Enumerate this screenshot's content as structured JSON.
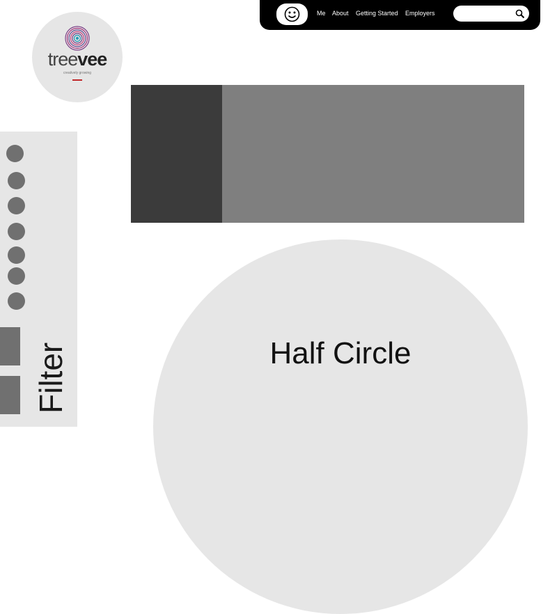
{
  "nav": {
    "items": [
      {
        "label": "Me"
      },
      {
        "label": "About"
      },
      {
        "label": "Getting Started"
      },
      {
        "label": "Employers"
      }
    ],
    "search": {
      "value": "",
      "placeholder": ""
    },
    "smiley_icon": "smiley-face-icon",
    "search_icon": "magnifier-icon"
  },
  "logo": {
    "text_light": "tree",
    "text_bold": "vee",
    "tagline": "creatively growing",
    "icon": "concentric-rings-icon"
  },
  "sidebar": {
    "filter_label": "Filter",
    "dot_count_shown": 7,
    "block_count_shown": 2
  },
  "main": {
    "half_circle_label": "Half Circle"
  },
  "colors": {
    "nav_background": "#000000",
    "banner_dark": "#3b3b3b",
    "banner_mid": "#7f7f7f",
    "panel_light": "#e6e6e6",
    "control_gray": "#707070"
  }
}
